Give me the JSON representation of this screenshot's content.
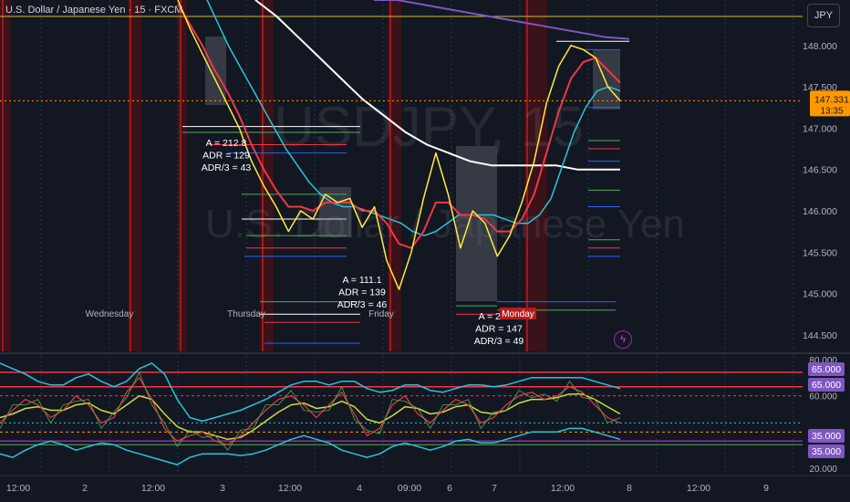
{
  "header": {
    "title": "U.S. Dollar / Japanese Yen · 15 · FXCM"
  },
  "currency_button": "JPY",
  "watermark": {
    "symbol": "USDJPY, 15",
    "name": "U.S. Dollar / Japanese Yen"
  },
  "price_badge": {
    "value": "147.331",
    "countdown": "13:35"
  },
  "colors": {
    "background": "#131722",
    "price_line": "#ff9800",
    "ema_fast": "#ffeb3b",
    "ema_mid": "#f23645",
    "ema_slow": "#26c6da",
    "sma_long": "#ffffff",
    "ma_purple": "#7e57c2",
    "band_upper": "#f23645",
    "band_lower": "#9c27b0"
  },
  "chart_data": [
    {
      "type": "line",
      "title": "U.S. Dollar / Japanese Yen · 15 · FXCM",
      "ylim": [
        144.3,
        148.55
      ],
      "y_ticks": [
        "148.000",
        "147.500",
        "147.000",
        "146.500",
        "146.000",
        "145.500",
        "145.000",
        "144.500"
      ],
      "day_labels": [
        "Wednesday",
        "Thursday",
        "Friday",
        "Monday"
      ],
      "last_price": 147.331,
      "series": [
        {
          "values": [
            148.55,
            148.2,
            147.9,
            147.6,
            147.3,
            147.0,
            146.6,
            146.3,
            146.05,
            145.75,
            146.0,
            145.9,
            146.2,
            146.1,
            146.15,
            145.8,
            146.05,
            145.4,
            145.05,
            145.5,
            146.15,
            146.7,
            146.2,
            145.55,
            146.0,
            145.85,
            145.45,
            145.7,
            146.1,
            146.6,
            147.3,
            147.75,
            148.0,
            147.95,
            147.85,
            147.5,
            147.33
          ]
        },
        {
          "values": [
            148.5,
            148.25,
            148.0,
            147.7,
            147.45,
            147.15,
            146.8,
            146.5,
            146.25,
            146.05,
            146.05,
            146.0,
            146.1,
            146.1,
            146.1,
            146.0,
            146.0,
            145.85,
            145.6,
            145.55,
            145.75,
            146.1,
            146.1,
            145.95,
            145.95,
            145.9,
            145.75,
            145.75,
            145.9,
            146.2,
            146.7,
            147.2,
            147.6,
            147.8,
            147.85,
            147.7,
            147.55
          ]
        },
        {
          "values": [
            148.6,
            148.3,
            148.0,
            147.75,
            147.5,
            147.25,
            147.0,
            146.75,
            146.55,
            146.35,
            146.2,
            146.1,
            146.05,
            146.05,
            146.0,
            145.95,
            145.9,
            145.85,
            145.75,
            145.7,
            145.75,
            145.85,
            145.95,
            145.95,
            145.95,
            145.95,
            145.9,
            145.85,
            145.85,
            145.95,
            146.15,
            146.55,
            146.95,
            147.25,
            147.45,
            147.5,
            147.45
          ]
        },
        {
          "values": [
            148.55,
            148.35,
            148.1,
            147.85,
            147.6,
            147.35,
            147.15,
            146.95,
            146.8,
            146.7,
            146.6,
            146.55,
            146.55,
            146.55,
            146.55,
            146.5,
            146.5,
            146.5
          ]
        },
        {
          "values": [
            148.55,
            148.55,
            148.5,
            148.45,
            148.4,
            148.35,
            148.3,
            148.25,
            148.2,
            148.15,
            148.1,
            148.08
          ]
        }
      ],
      "annotations": [
        {
          "lines": [
            "A = 212.8",
            "ADR = 129",
            "ADR/3 = 43"
          ]
        },
        {
          "lines": [
            "A = 111.1",
            "ADR = 139",
            "ADR/3 = 46"
          ]
        },
        {
          "lines": [
            "A = 203.5",
            "ADR = 147",
            "ADR/3 = 49"
          ]
        }
      ]
    },
    {
      "type": "line",
      "ylim": [
        18,
        82
      ],
      "y_ticks": [
        "80.000",
        "60.000",
        "40.000",
        "20.000"
      ],
      "level_labels": [
        "65.000",
        "65.000",
        "35.000",
        "35.000"
      ],
      "x_labels": [
        "12:00",
        "2",
        "12:00",
        "3",
        "12:00",
        "4",
        "09:00",
        "6",
        "7",
        "12:00",
        "8",
        "12:00",
        "9"
      ],
      "series": [
        {
          "values": [
            45,
            52,
            58,
            55,
            48,
            52,
            60,
            55,
            45,
            48,
            62,
            70,
            58,
            42,
            35,
            38,
            40,
            35,
            33,
            38,
            45,
            52,
            58,
            60,
            55,
            48,
            55,
            62,
            50,
            38,
            42,
            55,
            60,
            50,
            45,
            52,
            58,
            55,
            45,
            48,
            55,
            60,
            62,
            58,
            60,
            65,
            62,
            55,
            48,
            45
          ]
        },
        {
          "values": [
            48,
            50,
            53,
            54,
            52,
            52,
            55,
            56,
            52,
            50,
            55,
            60,
            58,
            50,
            43,
            40,
            40,
            38,
            36,
            37,
            41,
            46,
            51,
            55,
            56,
            53,
            54,
            57,
            54,
            47,
            45,
            49,
            54,
            53,
            50,
            51,
            54,
            55,
            51,
            50,
            52,
            56,
            58,
            58,
            59,
            61,
            61,
            58,
            54,
            50
          ]
        },
        {
          "values": [
            78,
            75,
            72,
            68,
            66,
            66,
            70,
            72,
            68,
            65,
            68,
            75,
            78,
            72,
            58,
            48,
            46,
            48,
            50,
            52,
            55,
            58,
            62,
            66,
            68,
            68,
            66,
            68,
            68,
            64,
            62,
            63,
            66,
            66,
            63,
            62,
            64,
            66,
            66,
            65,
            66,
            68,
            70,
            70,
            70,
            70,
            70,
            68,
            66,
            64
          ]
        },
        {
          "values": [
            28,
            26,
            30,
            33,
            35,
            33,
            30,
            32,
            34,
            33,
            30,
            28,
            26,
            24,
            22,
            26,
            28,
            28,
            28,
            27,
            28,
            30,
            33,
            36,
            38,
            36,
            34,
            30,
            28,
            26,
            28,
            32,
            34,
            32,
            30,
            32,
            35,
            36,
            34,
            34,
            36,
            38,
            40,
            40,
            40,
            42,
            42,
            40,
            38,
            36
          ]
        }
      ]
    }
  ]
}
